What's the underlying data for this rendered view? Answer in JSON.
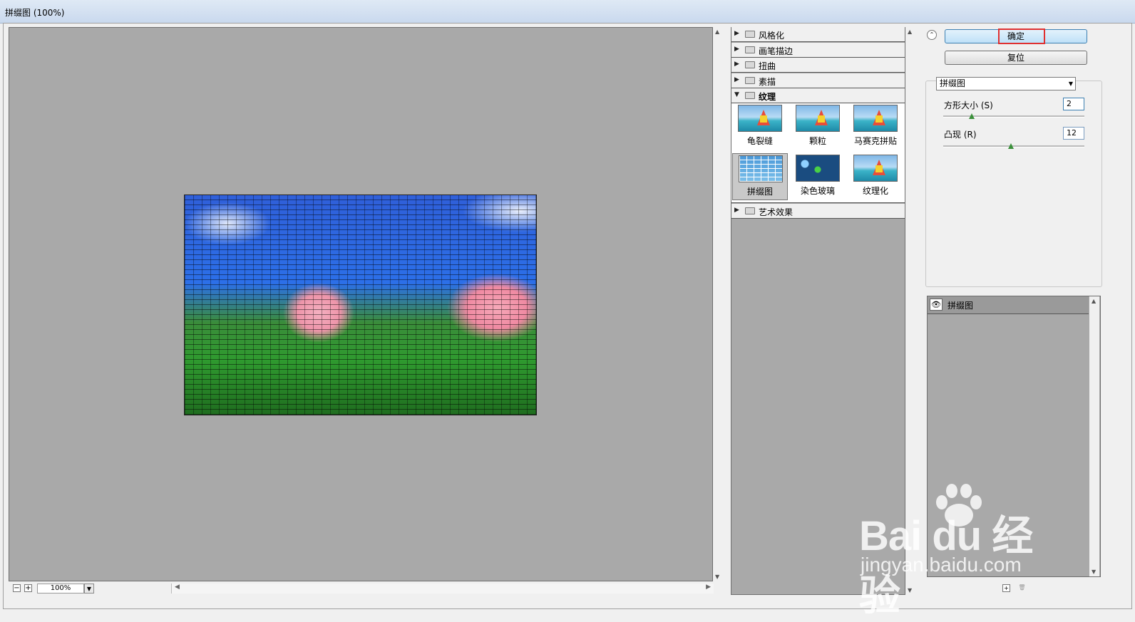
{
  "window": {
    "title": "拼缀图 (100%)"
  },
  "preview": {
    "zoom": "100%",
    "zoom_out": "−",
    "zoom_in": "+"
  },
  "categories": [
    {
      "label": "风格化",
      "expanded": false
    },
    {
      "label": "画笔描边",
      "expanded": false
    },
    {
      "label": "扭曲",
      "expanded": false
    },
    {
      "label": "素描",
      "expanded": false
    },
    {
      "label": "纹理",
      "expanded": true
    },
    {
      "label": "艺术效果",
      "expanded": false
    }
  ],
  "texture_filters": [
    {
      "label": "龟裂缝",
      "icon": "craquelure-thumb"
    },
    {
      "label": "颗粒",
      "icon": "grain-thumb"
    },
    {
      "label": "马赛克拼贴",
      "icon": "mosaic-tiles-thumb"
    },
    {
      "label": "拼缀图",
      "icon": "patchwork-thumb",
      "selected": true
    },
    {
      "label": "染色玻璃",
      "icon": "stained-glass-thumb"
    },
    {
      "label": "纹理化",
      "icon": "texturizer-thumb"
    }
  ],
  "buttons": {
    "ok": "确定",
    "reset": "复位"
  },
  "filter_select": {
    "value": "拼缀图"
  },
  "params": [
    {
      "label": "方形大小 (S)",
      "value": "2",
      "level_fraction": 0.2
    },
    {
      "label": "凸现 (R)",
      "value": "12",
      "level_fraction": 0.48
    }
  ],
  "layers": {
    "current": "拼缀图"
  },
  "watermark": {
    "brand": "Bai du 经验",
    "url": "jingyan.baidu.com"
  },
  "colors": {
    "highlight": "#e03030",
    "preview_bg": "#a9a9a9"
  }
}
